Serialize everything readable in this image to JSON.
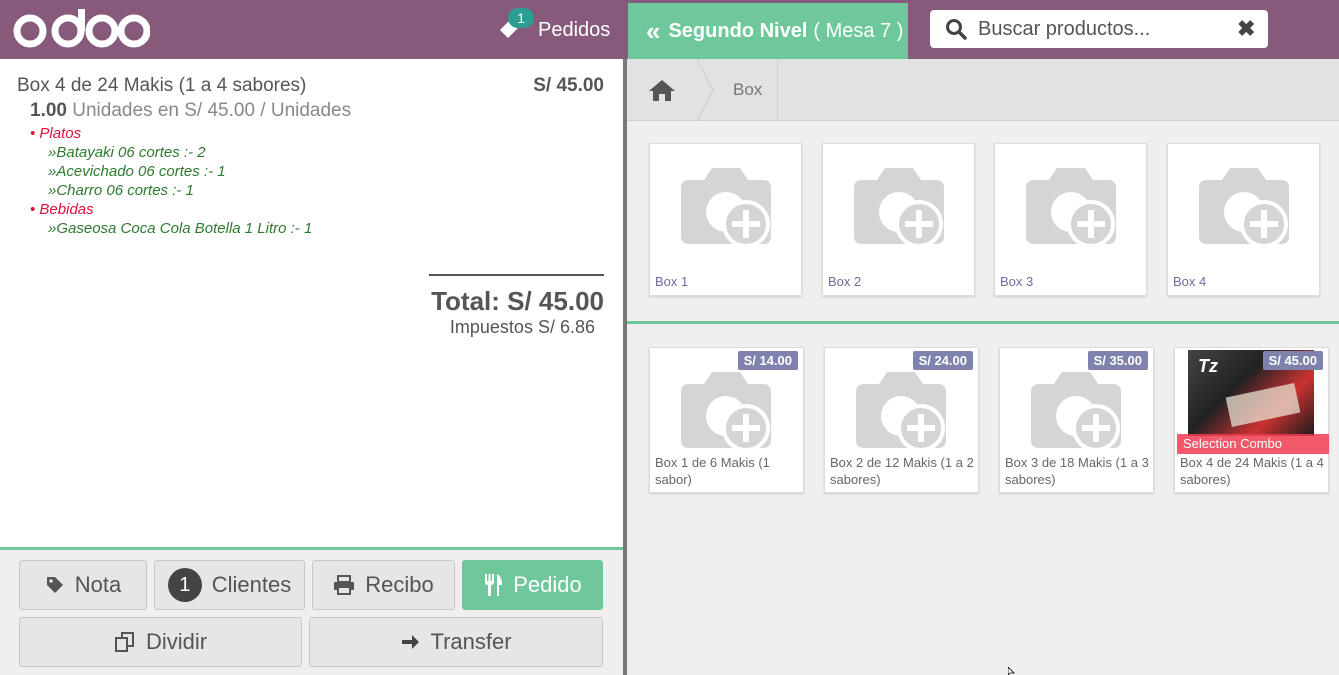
{
  "header": {
    "orders_count": "1",
    "orders_label": "Pedidos",
    "floor_level": "Segundo Nivel",
    "table_label": "( Mesa 7 )",
    "search_placeholder": "Buscar productos..."
  },
  "order": {
    "line": {
      "name": "Box 4 de 24 Makis (1 a 4 sabores)",
      "price": "S/ 45.00",
      "qty": "1.00",
      "unit_info": "Unidades en S/ 45.00 / Unidades"
    },
    "combo": [
      {
        "category": "Platos",
        "items": [
          "»Batayaki 06 cortes :- 2",
          "»Acevichado 06 cortes :- 1",
          "»Charro 06 cortes :- 1"
        ]
      },
      {
        "category": "Bebidas",
        "items": [
          "»Gaseosa Coca Cola Botella 1 Litro :- 1"
        ]
      }
    ],
    "total": "Total: S/ 45.00",
    "taxes": "Impuestos S/ 6.86"
  },
  "actions": {
    "nota": "Nota",
    "clientes_count": "1",
    "clientes": "Clientes",
    "recibo": "Recibo",
    "pedido": "Pedido",
    "dividir": "Dividir",
    "transfer": "Transfer"
  },
  "breadcrumb": {
    "current": "Box"
  },
  "categories": [
    "Box 1",
    "Box 2",
    "Box 3",
    "Box 4"
  ],
  "products": [
    {
      "name": "Box 1 de 6 Makis (1 sabor)",
      "price": "S/ 14.00"
    },
    {
      "name": "Box 2 de 12 Makis (1 a 2 sabores)",
      "price": "S/ 24.00"
    },
    {
      "name": "Box 3 de 18 Makis (1 a 3 sabores)",
      "price": "S/ 35.00"
    },
    {
      "name": "Box 4 de 24 Makis (1 a 4 sabores)",
      "price": "S/ 45.00",
      "ribbon": "Selection Combo",
      "image_logo": "Tz"
    }
  ],
  "colors": {
    "brand": "#875a7b",
    "accent": "#6ec89b",
    "price_tag": "#7f82ac"
  }
}
